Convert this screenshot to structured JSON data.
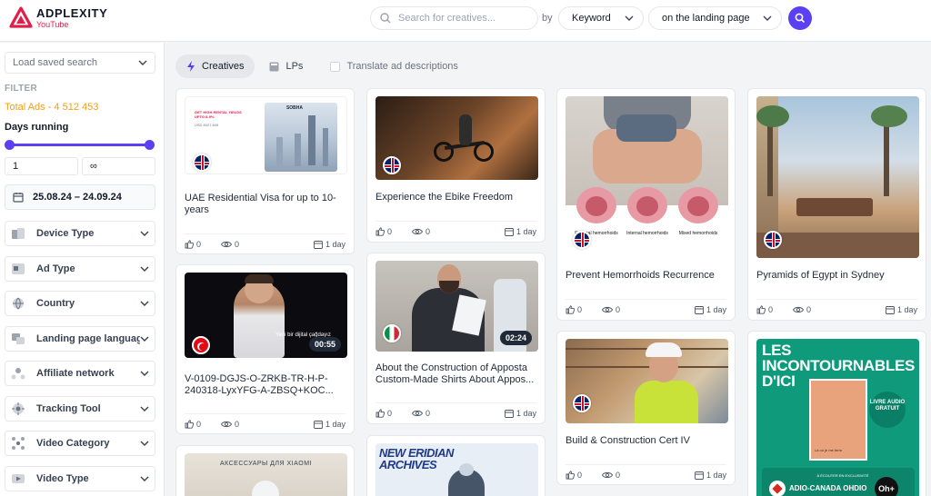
{
  "brand": {
    "name": "ADPLEXITY",
    "network": "YouTube"
  },
  "search": {
    "placeholder": "Search for creatives...",
    "by_label": "by",
    "field": "Keyword",
    "scope": "on the landing page"
  },
  "sidebar": {
    "saved_search": "Load saved search",
    "filter_label": "FILTER",
    "total_ads": "Total Ads - 4 512 453",
    "days_running_label": "Days running",
    "days_min": "1",
    "days_max": "∞",
    "date_range": "25.08.24 – 24.09.24",
    "filters": [
      {
        "label": "Device Type",
        "icon": "device-icon"
      },
      {
        "label": "Ad Type",
        "icon": "ad-type-icon"
      },
      {
        "label": "Country",
        "icon": "globe-icon"
      },
      {
        "label": "Landing page language",
        "icon": "language-icon"
      },
      {
        "label": "Affiliate network",
        "icon": "network-icon"
      },
      {
        "label": "Tracking Tool",
        "icon": "tracking-icon"
      },
      {
        "label": "Video Category",
        "icon": "category-icon"
      },
      {
        "label": "Video Type",
        "icon": "video-icon"
      }
    ]
  },
  "tabs": {
    "creatives": "Creatives",
    "lps": "LPs",
    "translate": "Translate ad descriptions"
  },
  "cards": [
    {
      "title": "UAE Residential Visa for up to 10-years",
      "likes": "0",
      "views": "0",
      "days": "1 day",
      "thumb_text": "GET HIGH RENTAL YIELDS UPTO 8-9%",
      "thumb_brand": "SOBHA",
      "thumb_price": "USD 8427,649"
    },
    {
      "title": "Experience the Ebike Freedom",
      "likes": "0",
      "views": "0",
      "days": "1 day"
    },
    {
      "title": "Prevent Hemorrhoids Recurrence",
      "likes": "0",
      "views": "0",
      "days": "1 day",
      "labels": [
        "External hemorrhoids",
        "Internal hemorrhoids",
        "Mixed hemorrhoids"
      ]
    },
    {
      "title": "Pyramids of Egypt in Sydney",
      "likes": "0",
      "views": "0",
      "days": "1 day"
    },
    {
      "title": "V-0109-DGJS-O-ZRKB-TR-H-P-240318-LyxYFG-A-ZBSQ+KOC...",
      "likes": "0",
      "views": "0",
      "days": "1 day",
      "duration": "00:55",
      "subtitle": "Yeni bir dijital çağdayız"
    },
    {
      "title": "About the Construction of Apposta Custom-Made Shirts About Appos...",
      "likes": "0",
      "views": "0",
      "days": "1 day",
      "duration": "02:24"
    },
    {
      "title": "Build & Construction Cert IV",
      "likes": "0",
      "views": "0",
      "days": "1 day"
    },
    {
      "title": "",
      "thumb_heading": "LES INCONTOURNABLES D'ICI",
      "badge": "LIVRE AUDIO GRATUIT",
      "footer": "À ÉCOUTER EN EXCLUSIVITÉ",
      "station": "ADIO-CANADA OHDIO",
      "oh": "Oh+",
      "book": "Là où je me terre"
    },
    {
      "title": "",
      "thumb_text": "АКСЕССУАРЫ ДЛЯ XIAOMI"
    },
    {
      "title": "",
      "thumb_text": "NEW ERIDIAN ARCHIVES"
    }
  ],
  "colors": {
    "accent": "#5b3ff2",
    "total_ads": "#f59e0b",
    "brand_red": "#e11d48"
  }
}
